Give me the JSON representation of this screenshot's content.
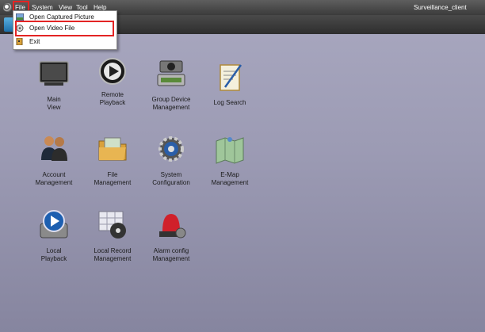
{
  "menubar": {
    "items": [
      "File",
      "System",
      "View",
      "Tool",
      "Help"
    ],
    "title": "Surveillance_client"
  },
  "file_menu": {
    "items": [
      "Open Captured Picture",
      "Open Video File",
      "Exit"
    ]
  },
  "tiles": [
    {
      "line1": "Main",
      "line2": "View",
      "icon": "monitor-icon"
    },
    {
      "line1": "Remote",
      "line2": "Playback",
      "icon": "remote-playback-icon"
    },
    {
      "line1": "Group Device",
      "line2": "Management",
      "icon": "group-device-icon"
    },
    {
      "line1": "Log Search",
      "line2": "",
      "icon": "log-search-icon"
    },
    {
      "line1": "Account",
      "line2": "Management",
      "icon": "users-icon"
    },
    {
      "line1": "File",
      "line2": "Management",
      "icon": "folder-icon"
    },
    {
      "line1": "System",
      "line2": "Configuration",
      "icon": "gear-icon"
    },
    {
      "line1": "E-Map",
      "line2": "Management",
      "icon": "map-icon"
    },
    {
      "line1": "Local",
      "line2": "Playback",
      "icon": "local-playback-icon"
    },
    {
      "line1": "Local Record",
      "line2": "Management",
      "icon": "local-record-icon"
    },
    {
      "line1": "Alarm config",
      "line2": "Management",
      "icon": "alarm-icon"
    }
  ],
  "colors": {
    "highlight": "#e32424",
    "menubar": "#4a4a4a"
  }
}
